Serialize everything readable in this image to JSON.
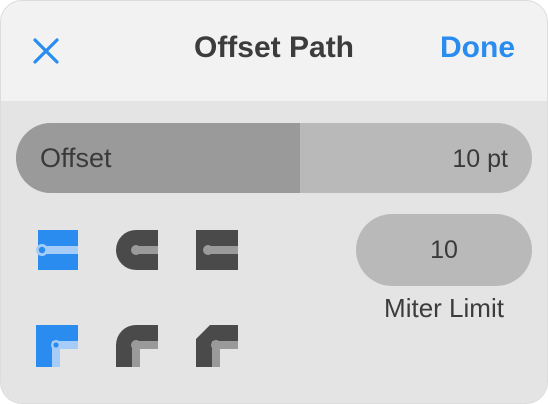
{
  "header": {
    "title": "Offset Path",
    "done_label": "Done",
    "close_icon": "close-icon"
  },
  "offset": {
    "label": "Offset",
    "value": "10 pt",
    "fill_fraction": 0.55
  },
  "end_caps": [
    {
      "name": "butt-cap-icon",
      "selected": true
    },
    {
      "name": "round-cap-icon",
      "selected": false
    },
    {
      "name": "projecting-cap-icon",
      "selected": false
    }
  ],
  "joins": [
    {
      "name": "miter-join-icon",
      "selected": true
    },
    {
      "name": "round-join-icon",
      "selected": false
    },
    {
      "name": "bevel-join-icon",
      "selected": false
    }
  ],
  "miter": {
    "value": "10",
    "label": "Miter Limit"
  },
  "colors": {
    "accent": "#2a8cef",
    "icon_dark": "#4a4a4a",
    "icon_light": "#9a9a9a",
    "selected_light": "#a6cdf7"
  }
}
